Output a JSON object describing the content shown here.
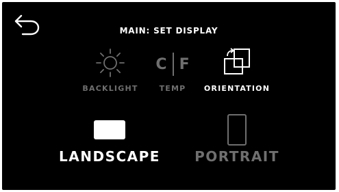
{
  "header": {
    "title": "MAIN: SET DISPLAY",
    "back_icon": "back-arrow-icon"
  },
  "menu": {
    "items": [
      {
        "label": "BACKLIGHT",
        "icon": "sun-icon",
        "active": false
      },
      {
        "label": "TEMP",
        "icon": "temp-unit-icon",
        "active": false,
        "glyph_left": "C",
        "glyph_right": "F"
      },
      {
        "label": "ORIENTATION",
        "icon": "orientation-icon",
        "active": true
      }
    ]
  },
  "options": {
    "items": [
      {
        "label": "LANDSCAPE",
        "icon": "landscape-icon",
        "selected": true
      },
      {
        "label": "PORTRAIT",
        "icon": "portrait-icon",
        "selected": false
      }
    ]
  },
  "colors": {
    "background": "#000000",
    "active": "#ffffff",
    "inactive": "#6f6f6f"
  }
}
